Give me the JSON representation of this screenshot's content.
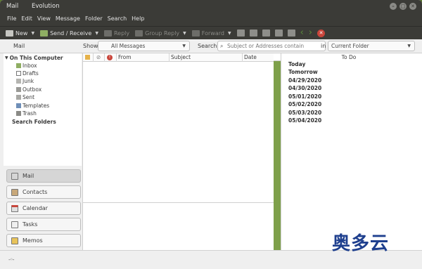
{
  "window": {
    "app_name": "Mail",
    "title": "Evolution",
    "controls": [
      "–",
      "□",
      "✕"
    ]
  },
  "menu": [
    "File",
    "Edit",
    "View",
    "Message",
    "Folder",
    "Search",
    "Help"
  ],
  "toolbar": {
    "new_label": "New",
    "send_receive_label": "Send / Receive",
    "reply_label": "Reply",
    "group_reply_label": "Group Reply",
    "forward_label": "Forward"
  },
  "searchbar": {
    "section_label": "Mail",
    "show_label": "Show:",
    "show_value": "All Messages",
    "search_label": "Search:",
    "search_placeholder": "Subject or Addresses contain",
    "in_label": "in",
    "scope_value": "Current Folder"
  },
  "folders": {
    "account": "On This Computer",
    "items": [
      "Inbox",
      "Drafts",
      "Junk",
      "Outbox",
      "Sent",
      "Templates",
      "Trash"
    ],
    "search_folders": "Search Folders"
  },
  "switcher": [
    "Mail",
    "Contacts",
    "Calendar",
    "Tasks",
    "Memos"
  ],
  "message_list": {
    "columns": [
      "From",
      "Subject",
      "Date"
    ]
  },
  "todo": {
    "title": "To Do",
    "dates": [
      "Today",
      "Tomorrow",
      "04/29/2020",
      "04/30/2020",
      "05/01/2020",
      "05/02/2020",
      "05/03/2020",
      "05/04/2020"
    ]
  },
  "watermark": "奥多云",
  "colors": {
    "titlebar": "#3b3b37",
    "accent_green": "#7ea04a",
    "stop_red": "#c9453b"
  }
}
